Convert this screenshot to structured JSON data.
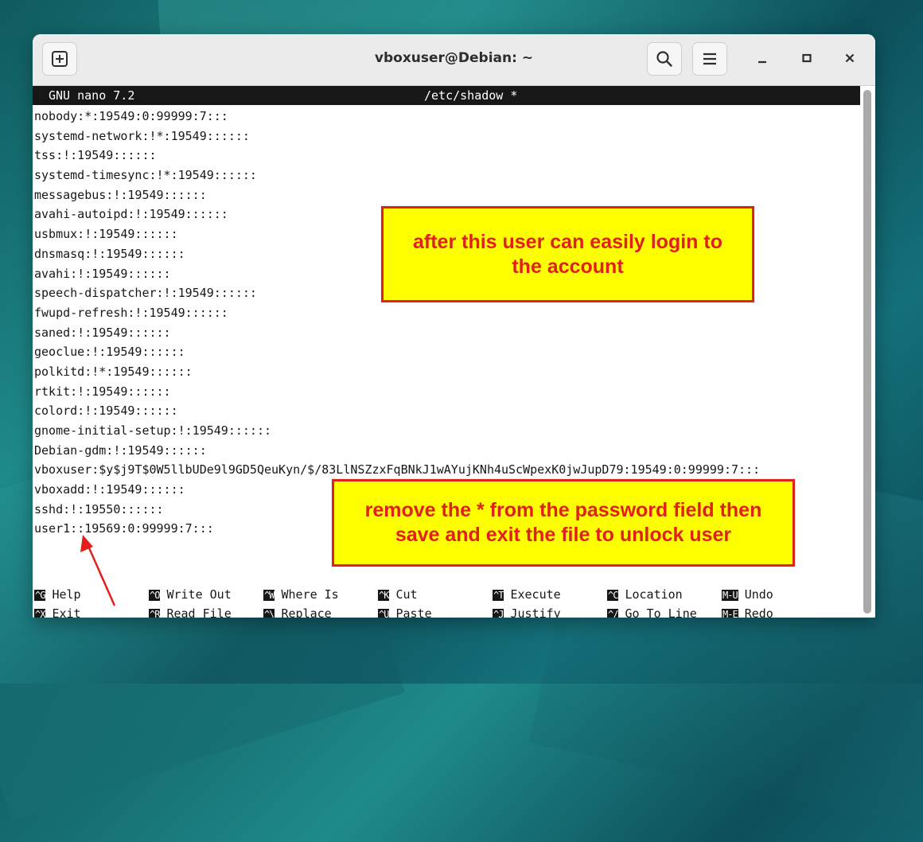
{
  "window": {
    "title": "vboxuser@Debian: ~"
  },
  "nano": {
    "version": "GNU nano 7.2",
    "filename": "/etc/shadow *"
  },
  "lines": [
    "nobody:*:19549:0:99999:7:::",
    "systemd-network:!*:19549::::::",
    "tss:!:19549::::::",
    "systemd-timesync:!*:19549::::::",
    "messagebus:!:19549::::::",
    "avahi-autoipd:!:19549::::::",
    "usbmux:!:19549::::::",
    "dnsmasq:!:19549::::::",
    "avahi:!:19549::::::",
    "speech-dispatcher:!:19549::::::",
    "fwupd-refresh:!:19549::::::",
    "saned:!:19549::::::",
    "geoclue:!:19549::::::",
    "polkitd:!*:19549::::::",
    "rtkit:!:19549::::::",
    "colord:!:19549::::::",
    "gnome-initial-setup:!:19549::::::",
    "Debian-gdm:!:19549::::::",
    "vboxuser:$y$j9T$0W5llbUDe9l9GD5QeuKyn/$/83LlNSZzxFqBNkJ1wAYujKNh4uScWpexK0jwJupD79:19549:0:99999:7:::",
    "vboxadd:!:19549::::::",
    "sshd:!:19550::::::",
    "user1::19569:0:99999:7:::"
  ],
  "shortcuts": [
    {
      "key": "^G",
      "label": "Help"
    },
    {
      "key": "^O",
      "label": "Write Out"
    },
    {
      "key": "^W",
      "label": "Where Is"
    },
    {
      "key": "^K",
      "label": "Cut"
    },
    {
      "key": "^T",
      "label": "Execute"
    },
    {
      "key": "^C",
      "label": "Location"
    },
    {
      "key": "M-U",
      "label": "Undo"
    },
    {
      "key": "^X",
      "label": "Exit"
    },
    {
      "key": "^R",
      "label": "Read File"
    },
    {
      "key": "^\\",
      "label": "Replace"
    },
    {
      "key": "^U",
      "label": "Paste"
    },
    {
      "key": "^J",
      "label": "Justify"
    },
    {
      "key": "^/",
      "label": "Go To Line"
    },
    {
      "key": "M-E",
      "label": "Redo"
    }
  ],
  "annotations": {
    "note1": "after this user can easily login to the account",
    "note2": "remove the * from the password field then save and exit the file to unlock user"
  },
  "icons": {
    "new_tab": "new-tab-icon",
    "search": "search-icon",
    "menu": "hamburger-menu-icon",
    "minimize": "minimize-icon",
    "maximize": "maximize-icon",
    "close": "close-icon"
  },
  "colors": {
    "note_bg": "#ffff00",
    "note_border": "#e0201a",
    "note_text": "#e0201a",
    "terminal_header_bg": "#171717"
  }
}
